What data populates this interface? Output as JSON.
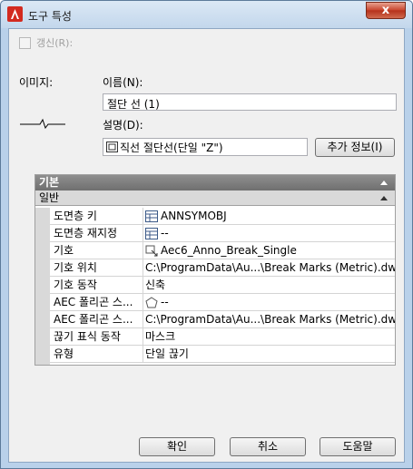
{
  "window": {
    "title": "도구 특성",
    "close_label": "x"
  },
  "update": {
    "label": "갱신(R):",
    "checked": false
  },
  "image_label": "이미지:",
  "name": {
    "label": "이름(N):",
    "value": "절단 선 (1)"
  },
  "description": {
    "label": "설명(D):",
    "value": "직선 절단선(단일 \"Z\")"
  },
  "more_info_button": "추가 정보(I)",
  "grid": {
    "category_basic": "기본",
    "category_general": "일반",
    "rows": [
      {
        "name": "도면층 키",
        "value": "ANNSYMOBJ",
        "icon": "table-icon"
      },
      {
        "name": "도면층 재지정",
        "value": "--",
        "icon": "table-icon"
      },
      {
        "name": "기호",
        "value": "Aec6_Anno_Break_Single",
        "icon": "symbol-icon"
      },
      {
        "name": "기호 위치",
        "value": "C:\\ProgramData\\Au...\\Break Marks (Metric).dwg",
        "icon": ""
      },
      {
        "name": "기호 동작",
        "value": "신축",
        "icon": ""
      },
      {
        "name": "AEC 폴리곤 스...",
        "value": "--",
        "icon": "polygon-icon"
      },
      {
        "name": "AEC 폴리곤 스...",
        "value": "C:\\ProgramData\\Au...\\Break Marks (Metric).dwg",
        "icon": ""
      },
      {
        "name": "끊기 표식 동작",
        "value": "마스크",
        "icon": ""
      },
      {
        "name": "유형",
        "value": "단일 끊기",
        "icon": ""
      }
    ]
  },
  "buttons": {
    "ok": "확인",
    "cancel": "취소",
    "help": "도움말"
  },
  "colors": {
    "title_bar": "#c3d7ec",
    "close_button": "#c7432b",
    "category_basic": "#7f7f7f",
    "app_icon": "#d32a1f"
  }
}
